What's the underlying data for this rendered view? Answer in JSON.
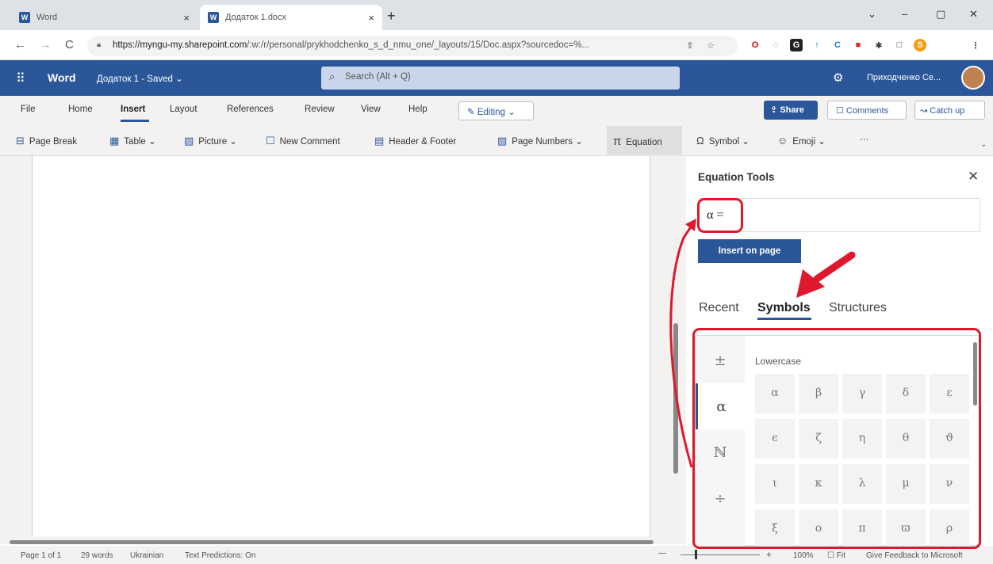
{
  "browser": {
    "tabs": [
      {
        "favicon": "W",
        "title": "Word",
        "close": "×"
      },
      {
        "favicon": "W",
        "title": "Додаток 1.docx",
        "close": "×"
      }
    ],
    "new_tab": "+",
    "window_controls": [
      "⌄",
      "–",
      "▢",
      "✕"
    ],
    "nav": [
      "←",
      "→",
      "C"
    ],
    "url_host": "https://myngu-my.sharepoint.com",
    "url_path": "/:w:/r/personal/prykhodchenko_s_d_nmu_one/_layouts/15/Doc.aspx?sourcedoc=%..."
  },
  "word_header": {
    "app_name": "Word",
    "doc_title": "Додаток 1 - Saved ⌄",
    "search_placeholder": "Search (Alt + Q)",
    "search_icon": "⌕",
    "user_name": "Приходченко Се..."
  },
  "ribbon_tabs": [
    "File",
    "Home",
    "Insert",
    "Layout",
    "References",
    "Review",
    "View",
    "Help"
  ],
  "editing_label": "✎ Editing ⌄",
  "share_label": "⇪ Share",
  "comments_label": "☐ Comments",
  "catchup_label": "↝ Catch up",
  "commands": [
    {
      "icon": "⊟",
      "label": "Page Break"
    },
    {
      "icon": "▦",
      "label": "Table ⌄"
    },
    {
      "icon": "▨",
      "label": "Picture ⌄"
    },
    {
      "icon": "☐",
      "label": "New Comment"
    },
    {
      "icon": "▤",
      "label": "Header & Footer"
    },
    {
      "icon": "▧",
      "label": "Page Numbers ⌄"
    },
    {
      "icon": "π",
      "label": "Equation"
    },
    {
      "icon": "Ω",
      "label": "Symbol ⌄"
    },
    {
      "icon": "☺",
      "label": "Emoji ⌄"
    },
    {
      "icon": "",
      "label": "···"
    }
  ],
  "equation_pane": {
    "title": "Equation Tools",
    "close": "✕",
    "equation_value": "α =",
    "insert_button": "Insert on page",
    "tabs": [
      "Recent",
      "Symbols",
      "Structures"
    ],
    "categories": [
      "±",
      "α",
      "ℕ",
      "÷"
    ],
    "group_label": "Lowercase",
    "symbols": [
      "α",
      "β",
      "γ",
      "δ",
      "ε",
      "ϵ",
      "ζ",
      "η",
      "θ",
      "ϑ",
      "ι",
      "κ",
      "λ",
      "μ",
      "ν",
      "ξ",
      "ο",
      "π",
      "ϖ",
      "ρ"
    ]
  },
  "status_bar": {
    "page": "Page 1 of 1",
    "words": "29 words",
    "language": "Ukrainian",
    "predictions": "Text Predictions: On",
    "zoom_minus": "—",
    "zoom_plus": "+",
    "zoom": "100%",
    "fit": "☐ Fit",
    "feedback": "Give Feedback to Microsoft"
  }
}
